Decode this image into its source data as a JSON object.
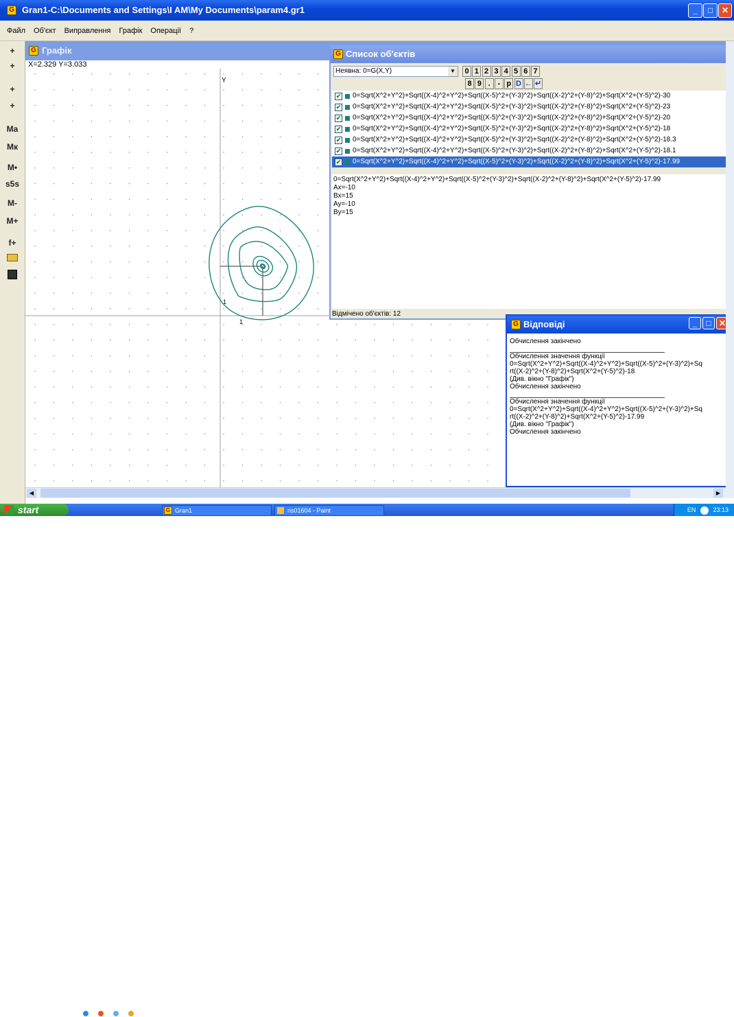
{
  "window": {
    "title": "Gran1-C:\\Documents and Settings\\I AM\\My Documents\\param4.gr1",
    "icon": "G"
  },
  "menu": [
    "Файл",
    "Об'єкт",
    "Виправлення",
    "Графік",
    "Операції",
    "?"
  ],
  "toolbar": {
    "tools": [
      "+",
      "+",
      "+",
      "+",
      "Ma",
      "Mк",
      "M•",
      "s5s",
      "M-",
      "M+",
      "f+",
      "open-folder-icon",
      "save-disk-icon"
    ]
  },
  "graph": {
    "title": "Графік",
    "coords": "X=2.329  Y=3.033",
    "axis_y_label": "Y",
    "tick_x": "1",
    "tick_y": "1"
  },
  "objects": {
    "title": "Список об'єктів",
    "type_select": "Неявна: 0=G(X,Y)",
    "keys_row1": [
      "0",
      "1",
      "2",
      "3",
      "4",
      "5",
      "6",
      "7"
    ],
    "keys_row2": [
      "8",
      "9",
      ".",
      "-",
      "p",
      "D",
      "←",
      "↵"
    ],
    "items": [
      "0=Sqrt(X^2+Y^2)+Sqrt((X-4)^2+Y^2)+Sqrt((X-5)^2+(Y-3)^2)+Sqrt((X-2)^2+(Y-8)^2)+Sqrt(X^2+(Y-5)^2)-30",
      "0=Sqrt(X^2+Y^2)+Sqrt((X-4)^2+Y^2)+Sqrt((X-5)^2+(Y-3)^2)+Sqrt((X-2)^2+(Y-8)^2)+Sqrt(X^2+(Y-5)^2)-23",
      "0=Sqrt(X^2+Y^2)+Sqrt((X-4)^2+Y^2)+Sqrt((X-5)^2+(Y-3)^2)+Sqrt((X-2)^2+(Y-8)^2)+Sqrt(X^2+(Y-5)^2)-20",
      "0=Sqrt(X^2+Y^2)+Sqrt((X-4)^2+Y^2)+Sqrt((X-5)^2+(Y-3)^2)+Sqrt((X-2)^2+(Y-8)^2)+Sqrt(X^2+(Y-5)^2)-18",
      "0=Sqrt(X^2+Y^2)+Sqrt((X-4)^2+Y^2)+Sqrt((X-5)^2+(Y-3)^2)+Sqrt((X-2)^2+(Y-8)^2)+Sqrt(X^2+(Y-5)^2)-18.3",
      "0=Sqrt(X^2+Y^2)+Sqrt((X-4)^2+Y^2)+Sqrt((X-5)^2+(Y-3)^2)+Sqrt((X-2)^2+(Y-8)^2)+Sqrt(X^2+(Y-5)^2)-18.1",
      "0=Sqrt(X^2+Y^2)+Sqrt((X-4)^2+Y^2)+Sqrt((X-5)^2+(Y-3)^2)+Sqrt((X-2)^2+(Y-8)^2)+Sqrt(X^2+(Y-5)^2)-17.99"
    ],
    "detail": [
      "0=Sqrt(X^2+Y^2)+Sqrt((X-4)^2+Y^2)+Sqrt((X-5)^2+(Y-3)^2)+Sqrt((X-2)^2+(Y-8)^2)+Sqrt(X^2+(Y-5)^2)-17.99",
      "Ax=-10",
      "Bx=15",
      "Ay=-10",
      "By=15"
    ],
    "status": "Відмічено об'єктів: 12"
  },
  "answers": {
    "title": "Відповіді",
    "lines": [
      {
        "t": "Обчислення закінчено"
      },
      {
        "rule": true
      },
      {
        "t": "Обчислення значення функції"
      },
      {
        "t": "0=Sqrt(X^2+Y^2)+Sqrt((X-4)^2+Y^2)+Sqrt((X-5)^2+(Y-3)^2)+Sq"
      },
      {
        "t": "rt((X-2)^2+(Y-8)^2)+Sqrt(X^2+(Y-5)^2)-18"
      },
      {
        "t": "(Див. вікно \"Графік\")"
      },
      {
        "t": "Обчислення закінчено"
      },
      {
        "rule": true
      },
      {
        "t": "Обчислення значення функції"
      },
      {
        "t": "0=Sqrt(X^2+Y^2)+Sqrt((X-4)^2+Y^2)+Sqrt((X-5)^2+(Y-3)^2)+Sq"
      },
      {
        "t": "rt((X-2)^2+(Y-8)^2)+Sqrt(X^2+(Y-5)^2)-17.99"
      },
      {
        "t": "(Див. вікно \"Графік\")"
      },
      {
        "t": "Обчислення закінчено"
      }
    ]
  },
  "taskbar": {
    "start": "start",
    "tasks": [
      "Gran1",
      "ris01604 - Paint"
    ],
    "lang": "EN",
    "clock": "23:13"
  },
  "colors": {
    "curve": "#1b8580",
    "titlebar": "#0a48d8",
    "selection": "#316ac5"
  }
}
